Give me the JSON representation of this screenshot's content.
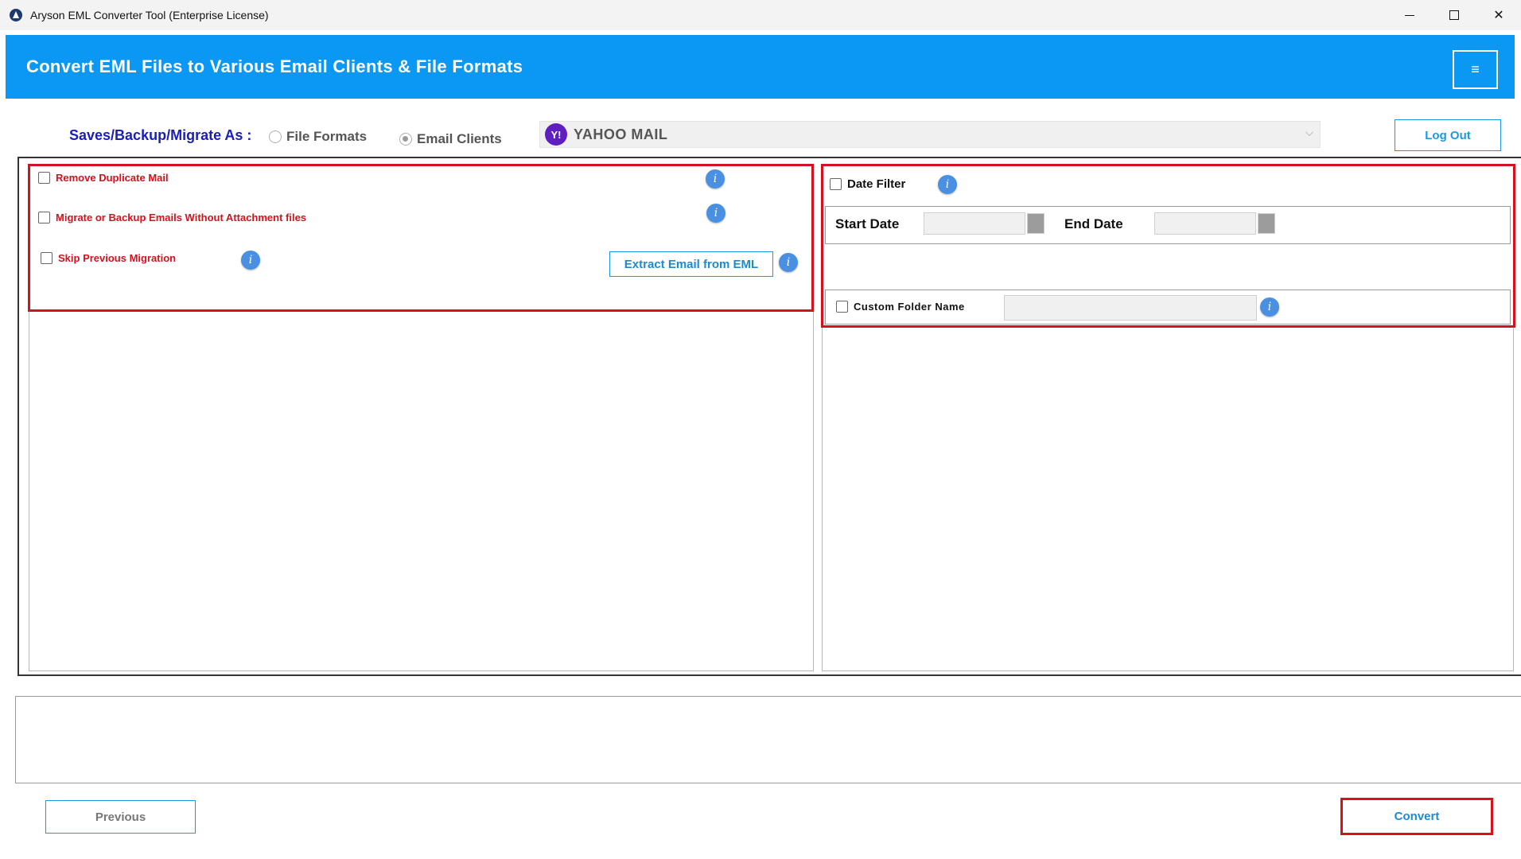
{
  "window": {
    "title": "Aryson EML Converter Tool (Enterprise License)",
    "minimize": "—",
    "close": "✕"
  },
  "header": {
    "title": "Convert EML Files to Various Email Clients & File Formats",
    "menu_icon": "≡"
  },
  "saveas": {
    "label": "Saves/Backup/Migrate As :",
    "options": [
      {
        "label": "File Formats",
        "selected": false
      },
      {
        "label": "Email Clients",
        "selected": true
      }
    ],
    "selected_client": "YAHOO MAIL",
    "client_logo": "Y!",
    "logout_label": "Log Out"
  },
  "left_options": {
    "remove_duplicate": "Remove Duplicate Mail",
    "without_attachments": "Migrate or Backup Emails Without Attachment files",
    "skip_previous": "Skip Previous Migration",
    "extract_button": "Extract Email from EML",
    "info_glyph": "i"
  },
  "right_options": {
    "date_filter": "Date Filter",
    "start_date": "Start Date",
    "end_date": "End Date",
    "custom_folder": "Custom Folder Name"
  },
  "footer": {
    "previous": "Previous",
    "convert": "Convert"
  },
  "colors": {
    "banner": "#0b98f5",
    "highlight_red": "#d4111d",
    "accent_blue": "#1a9ae0",
    "label_navy": "#1a1fb5"
  }
}
